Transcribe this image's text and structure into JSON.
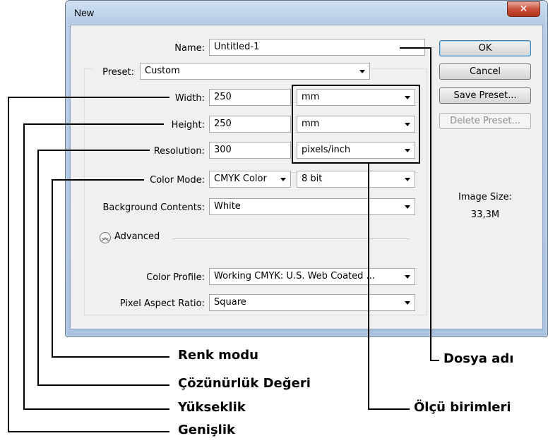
{
  "dialog": {
    "title": "New",
    "close_icon": "close-icon",
    "name_label": "Name:",
    "name_value": "Untitled-1",
    "preset_label": "Preset:",
    "preset_value": "Custom",
    "width_label": "Width:",
    "width_value": "250",
    "width_unit": "mm",
    "height_label": "Height:",
    "height_value": "250",
    "height_unit": "mm",
    "resolution_label": "Resolution:",
    "resolution_value": "300",
    "resolution_unit": "pixels/inch",
    "color_mode_label": "Color Mode:",
    "color_mode_value": "CMYK Color",
    "bit_depth_value": "8 bit",
    "background_label": "Background Contents:",
    "background_value": "White",
    "advanced_label": "Advanced",
    "color_profile_label": "Color Profile:",
    "color_profile_value": "Working CMYK:  U.S. Web Coated ...",
    "pixel_aspect_label": "Pixel Aspect Ratio:",
    "pixel_aspect_value": "Square",
    "buttons": {
      "ok": "OK",
      "cancel": "Cancel",
      "save_preset": "Save Preset...",
      "delete_preset": "Delete Preset..."
    },
    "image_size_label": "Image Size:",
    "image_size_value": "33,3M"
  },
  "annotations": {
    "renk_modu": "Renk modu",
    "cozunurluk": "Çözünürlük Değeri",
    "yukseklik": "Yükseklik",
    "genislik": "Genişlik",
    "dosya_adi": "Dosya adı",
    "olcu_birimleri": "Ölçü birimleri"
  }
}
